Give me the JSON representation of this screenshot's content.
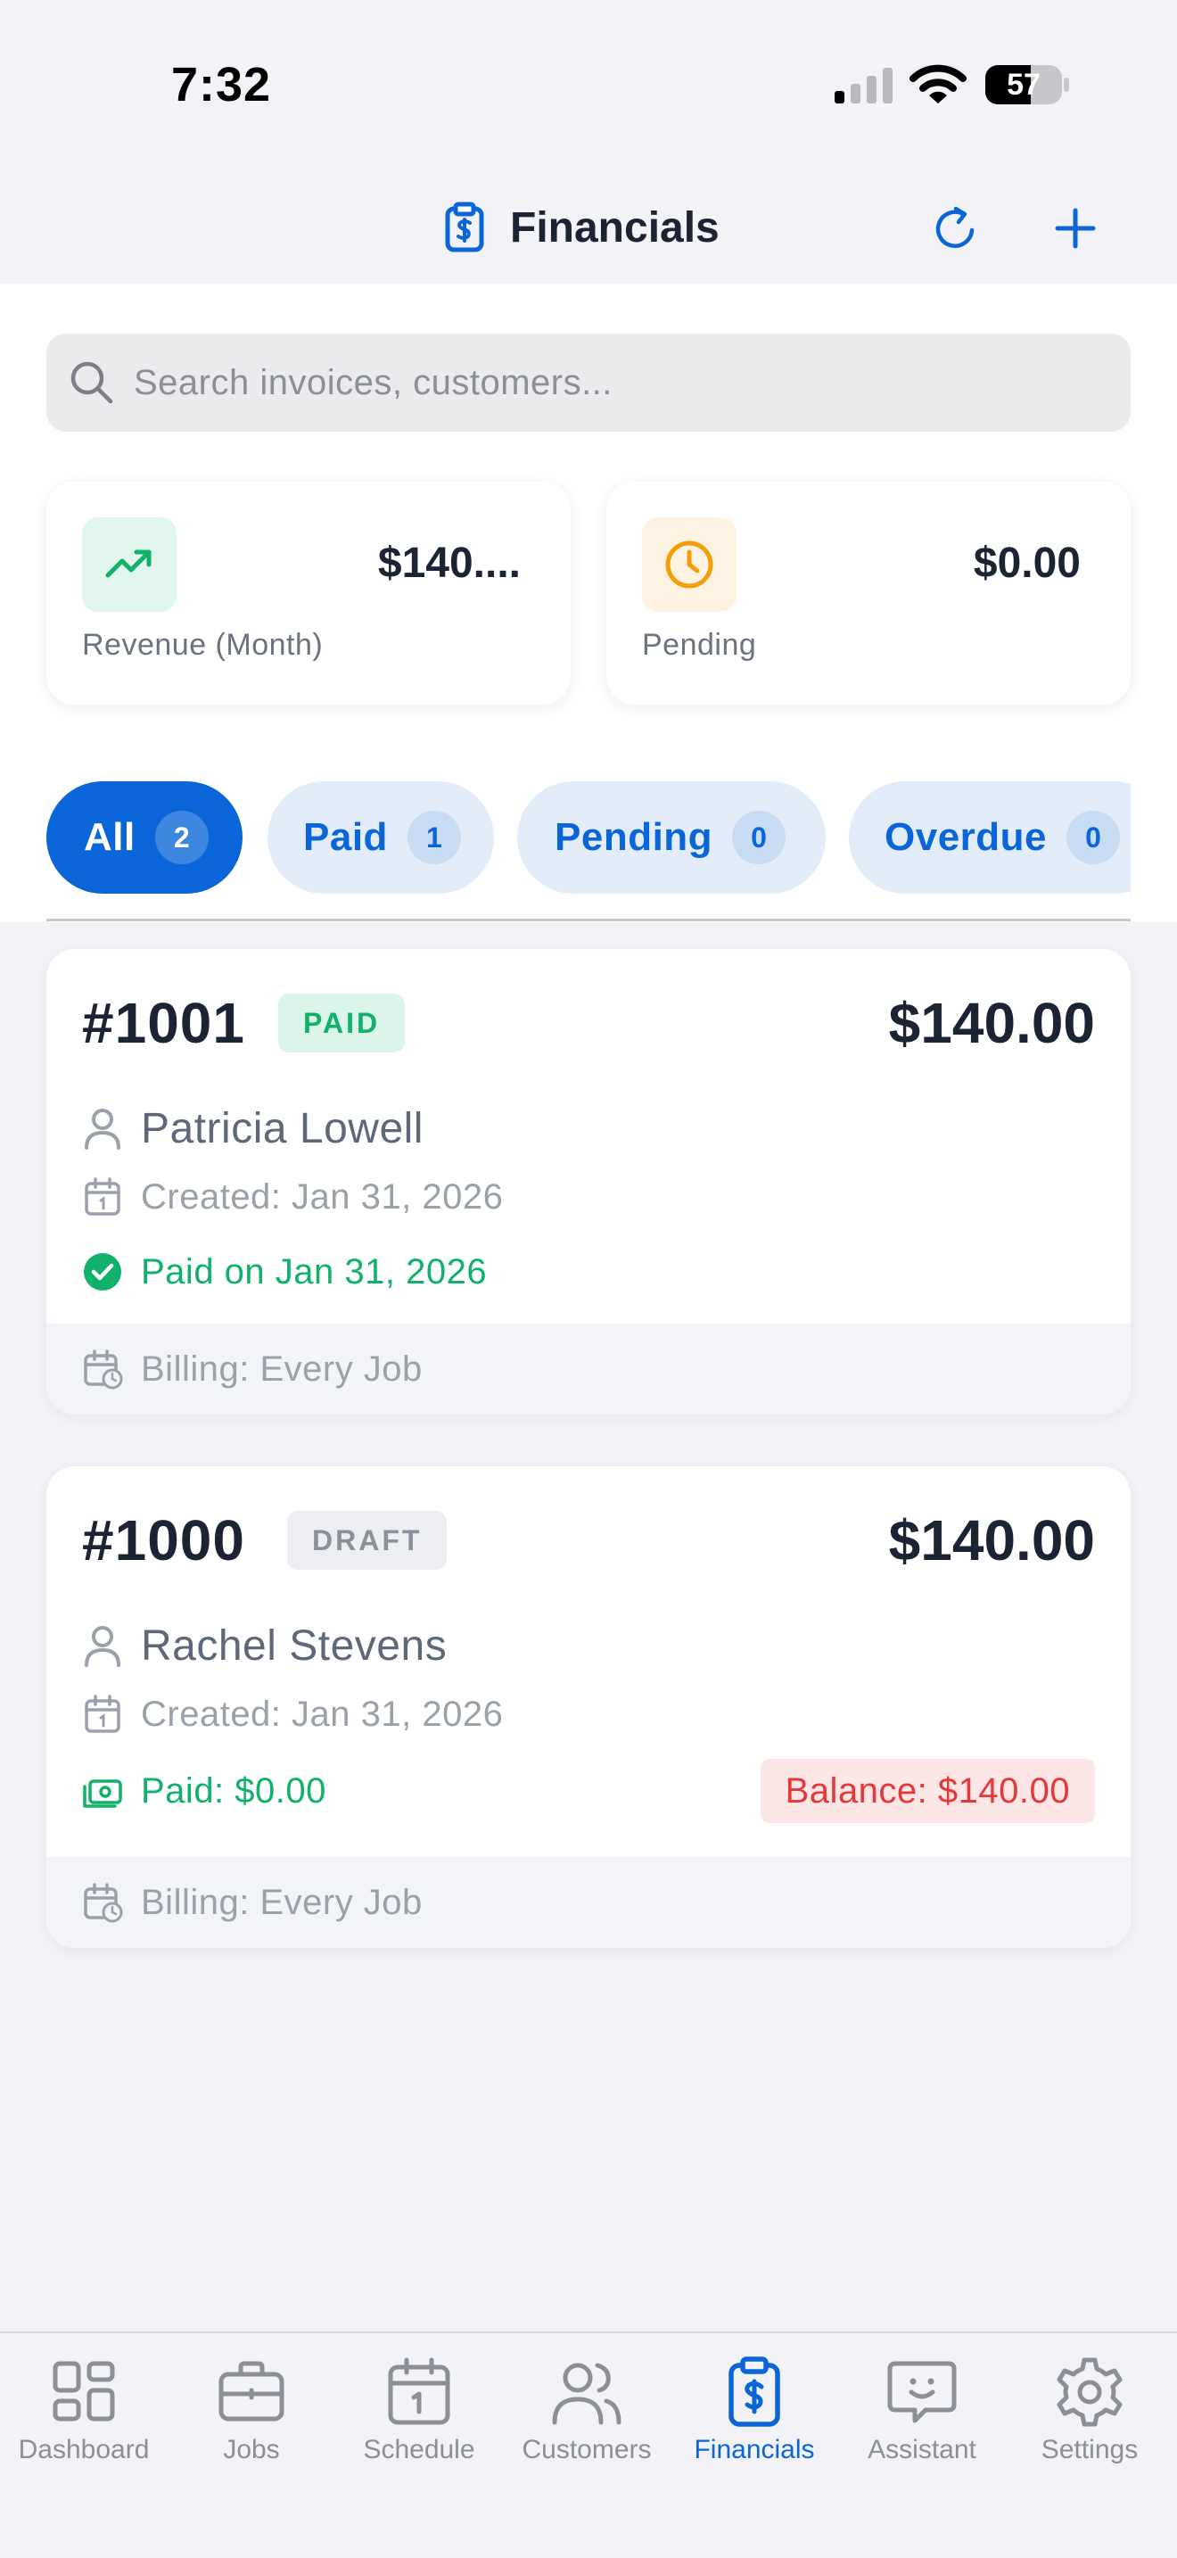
{
  "status_bar": {
    "time": "7:32",
    "battery": "57"
  },
  "header": {
    "title": "Financials"
  },
  "search": {
    "placeholder": "Search invoices, customers..."
  },
  "stats": [
    {
      "value": "$140....",
      "label": "Revenue (Month)"
    },
    {
      "value": "$0.00",
      "label": "Pending"
    }
  ],
  "filters": [
    {
      "label": "All",
      "count": "2",
      "active": true
    },
    {
      "label": "Paid",
      "count": "1"
    },
    {
      "label": "Pending",
      "count": "0"
    },
    {
      "label": "Overdue",
      "count": "0"
    }
  ],
  "invoices": [
    {
      "number": "#1001",
      "status": "PAID",
      "amount": "$140.00",
      "customer": "Patricia Lowell",
      "created": "Created: Jan 31, 2026",
      "paid_info": "Paid on Jan 31, 2026",
      "billing": "Billing: Every Job"
    },
    {
      "number": "#1000",
      "status": "DRAFT",
      "amount": "$140.00",
      "customer": "Rachel Stevens",
      "created": "Created: Jan 31, 2026",
      "paid_info": "Paid: $0.00",
      "balance": "Balance: $140.00",
      "billing": "Billing: Every Job"
    }
  ],
  "tabs": [
    {
      "label": "Dashboard",
      "icon": "dashboard-icon"
    },
    {
      "label": "Jobs",
      "icon": "briefcase-icon"
    },
    {
      "label": "Schedule",
      "icon": "calendar-icon"
    },
    {
      "label": "Customers",
      "icon": "users-icon"
    },
    {
      "label": "Financials",
      "icon": "clipboard-dollar-icon",
      "active": true
    },
    {
      "label": "Assistant",
      "icon": "chat-icon"
    },
    {
      "label": "Settings",
      "icon": "gear-icon"
    }
  ],
  "colors": {
    "accent": "#0a66d8",
    "success": "#10b26b",
    "danger": "#e5383b",
    "warning": "#f59e0b"
  }
}
